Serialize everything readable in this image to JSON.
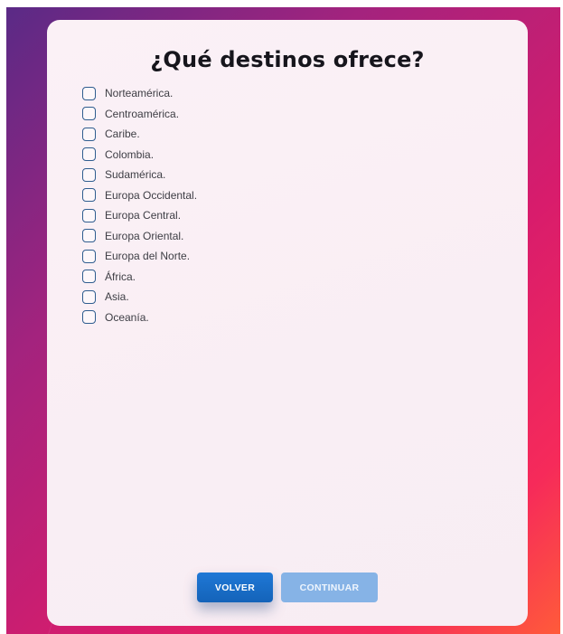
{
  "title": "¿Qué destinos ofrece?",
  "options": [
    {
      "label": "Norteamérica.",
      "checked": false
    },
    {
      "label": "Centroamérica.",
      "checked": false
    },
    {
      "label": "Caribe.",
      "checked": false
    },
    {
      "label": "Colombia.",
      "checked": false
    },
    {
      "label": "Sudamérica.",
      "checked": false
    },
    {
      "label": "Europa Occidental.",
      "checked": false
    },
    {
      "label": "Europa Central.",
      "checked": false
    },
    {
      "label": "Europa Oriental.",
      "checked": false
    },
    {
      "label": "Europa del Norte.",
      "checked": false
    },
    {
      "label": "África.",
      "checked": false
    },
    {
      "label": "Asia.",
      "checked": false
    },
    {
      "label": "Oceanía.",
      "checked": false
    }
  ],
  "buttons": {
    "back_label": "VOLVER",
    "next_label": "CONTINUAR",
    "next_disabled": true
  },
  "colors": {
    "primary": "#1a6fcc",
    "primary_disabled": "#86b3e6",
    "checkbox_border": "#2f5d8f",
    "card_bg": "#fbf1f6"
  }
}
